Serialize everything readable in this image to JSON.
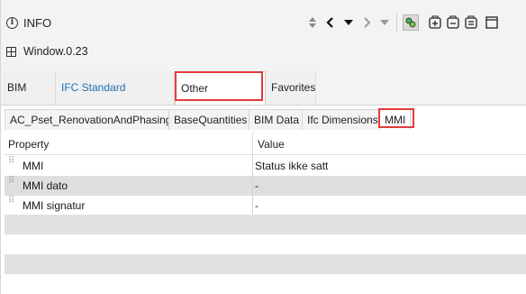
{
  "titlebar": {
    "title": "INFO",
    "icons": [
      "info-circle-icon",
      "sort-updown-icon",
      "chevron-left-icon",
      "dropdown-arrow-icon",
      "chevron-right-icon",
      "dropdown-arrow-gray-icon",
      "object-filter-icon",
      "add-group-icon",
      "remove-group-icon",
      "list-group-icon",
      "maximize-window-icon"
    ]
  },
  "window": {
    "label": "Window.0.23"
  },
  "main_tabs": [
    {
      "label": "BIM Data"
    },
    {
      "label": "IFC Standard Properties"
    },
    {
      "label": "Other Properties",
      "active": true
    },
    {
      "label": "Favorites"
    }
  ],
  "sub_tabs": [
    {
      "label": "AC_Pset_RenovationAndPhasing"
    },
    {
      "label": "BaseQuantities"
    },
    {
      "label": "BIM Data"
    },
    {
      "label": "Ifc Dimensions"
    },
    {
      "label": "MMI",
      "active": true
    }
  ],
  "table": {
    "headers": {
      "property": "Property",
      "value": "Value"
    },
    "rows": [
      {
        "property": "MMI",
        "value": "Status ikke satt"
      },
      {
        "property": "MMI dato",
        "value": "-"
      },
      {
        "property": "MMI signatur",
        "value": "-"
      }
    ]
  },
  "colors": {
    "highlight": "#e23b3b",
    "link": "#1f6fb3",
    "alt_row": "#dedede"
  }
}
